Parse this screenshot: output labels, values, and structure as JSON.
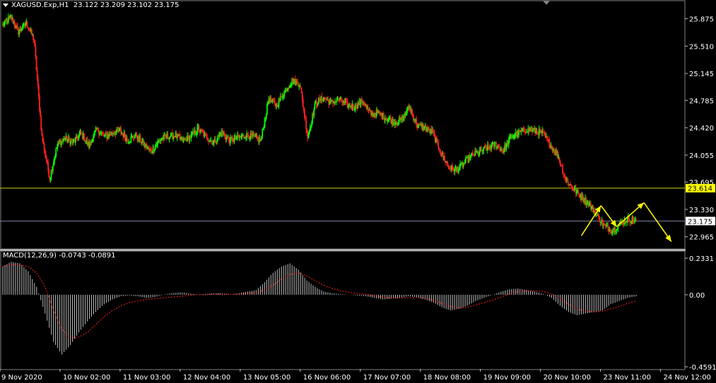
{
  "header": {
    "symbol": "XAGUSD.Exp,H1",
    "ohlc": "23.122 23.209 23.102 23.175"
  },
  "macd_header": {
    "label": "MACD(12,26,9)",
    "values": "-0.0743 -0.0891"
  },
  "colors": {
    "background": "#000000",
    "bull_candle": "#00ff00",
    "bear_candle": "#ff2020",
    "level_line": "#cccc00",
    "current_price_line": "#8080a0",
    "arrows": "#ffff00",
    "macd_hist": "#c0c0c0",
    "macd_signal": "#ff2020"
  },
  "chart_data": [
    {
      "type": "candlestick",
      "title": "XAGUSD.Exp,H1",
      "y_ticks": [
        "25.875",
        "25.510",
        "25.145",
        "24.785",
        "24.420",
        "24.055",
        "23.695",
        "23.330",
        "22.965"
      ],
      "ylim": [
        22.83,
        26.05
      ],
      "x_tick_labels": [
        "9 Nov 2020",
        "10 Nov 02:00",
        "11 Nov 03:00",
        "12 Nov 04:00",
        "13 Nov 05:00",
        "16 Nov 06:00",
        "17 Nov 07:00",
        "18 Nov 08:00",
        "19 Nov 09:00",
        "20 Nov 10:00",
        "23 Nov 11:00",
        "24 Nov 12:00"
      ],
      "horizontal_levels": [
        {
          "value": 23.614,
          "label": "23.614",
          "kind": "level"
        },
        {
          "value": 23.175,
          "label": "23.175",
          "kind": "current_price"
        }
      ],
      "close_path": [
        25.78,
        25.9,
        25.7,
        25.82,
        25.6,
        24.3,
        23.75,
        24.2,
        24.28,
        24.22,
        24.35,
        24.18,
        24.4,
        24.3,
        24.35,
        24.38,
        24.25,
        24.32,
        24.2,
        24.1,
        24.25,
        24.3,
        24.32,
        24.25,
        24.3,
        24.4,
        24.3,
        24.22,
        24.35,
        24.25,
        24.28,
        24.32,
        24.3,
        24.25,
        24.8,
        24.72,
        24.9,
        25.05,
        25.0,
        24.3,
        24.75,
        24.82,
        24.75,
        24.8,
        24.72,
        24.7,
        24.78,
        24.6,
        24.62,
        24.55,
        24.5,
        24.52,
        24.7,
        24.45,
        24.42,
        24.35,
        24.1,
        23.9,
        23.85,
        23.95,
        24.05,
        24.1,
        24.15,
        24.2,
        24.12,
        24.3,
        24.35,
        24.4,
        24.38,
        24.35,
        24.2,
        24.05,
        23.72,
        23.6,
        23.5,
        23.4,
        23.25,
        23.1,
        23.05,
        23.15,
        23.2,
        23.175
      ],
      "annotations": [
        {
          "kind": "arrow",
          "from": [
            74.0,
            22.98
          ],
          "to": [
            76.5,
            23.38
          ]
        },
        {
          "kind": "arrow",
          "from": [
            76.5,
            23.38
          ],
          "to": [
            78.5,
            23.1
          ]
        },
        {
          "kind": "arrow",
          "from": [
            78.5,
            23.1
          ],
          "to": [
            82.0,
            23.42
          ]
        },
        {
          "kind": "arrow",
          "from": [
            82.0,
            23.42
          ],
          "to": [
            85.5,
            22.9
          ]
        }
      ]
    },
    {
      "type": "bar",
      "title": "MACD(12,26,9)",
      "y_ticks": [
        "0.2331",
        "0.00",
        "-0.4591"
      ],
      "ylim": [
        -0.4591,
        0.2331
      ],
      "series": [
        {
          "name": "histogram",
          "values": [
            0.18,
            0.21,
            0.2,
            0.15,
            0.05,
            -0.12,
            -0.3,
            -0.38,
            -0.32,
            -0.24,
            -0.17,
            -0.11,
            -0.06,
            -0.03,
            -0.01,
            -0.005,
            -0.01,
            -0.02,
            -0.015,
            0.0,
            0.01,
            0.015,
            0.01,
            0.0,
            0.005,
            0.01,
            0.01,
            0.0,
            0.01,
            0.02,
            0.03,
            0.08,
            0.14,
            0.18,
            0.2,
            0.16,
            0.09,
            0.05,
            0.02,
            0.01,
            0.005,
            0.0,
            -0.005,
            -0.01,
            -0.02,
            -0.03,
            -0.025,
            -0.02,
            -0.01,
            -0.015,
            -0.03,
            -0.05,
            -0.08,
            -0.1,
            -0.09,
            -0.07,
            -0.04,
            -0.02,
            0.0,
            0.02,
            0.035,
            0.04,
            0.03,
            0.02,
            0.005,
            -0.02,
            -0.07,
            -0.11,
            -0.13,
            -0.12,
            -0.11,
            -0.1,
            -0.06,
            -0.04,
            -0.02,
            -0.01
          ]
        },
        {
          "name": "signal",
          "values": [
            0.18,
            0.19,
            0.19,
            0.18,
            0.14,
            0.05,
            -0.1,
            -0.22,
            -0.28,
            -0.27,
            -0.24,
            -0.19,
            -0.14,
            -0.1,
            -0.07,
            -0.05,
            -0.04,
            -0.03,
            -0.025,
            -0.02,
            -0.015,
            -0.01,
            -0.005,
            0.0,
            0.0,
            0.002,
            0.004,
            0.003,
            0.004,
            0.008,
            0.012,
            0.03,
            0.06,
            0.1,
            0.13,
            0.14,
            0.12,
            0.09,
            0.06,
            0.04,
            0.025,
            0.015,
            0.008,
            0.003,
            -0.005,
            -0.015,
            -0.02,
            -0.02,
            -0.018,
            -0.018,
            -0.023,
            -0.035,
            -0.055,
            -0.075,
            -0.085,
            -0.08,
            -0.065,
            -0.05,
            -0.035,
            -0.015,
            0.005,
            0.02,
            0.025,
            0.025,
            0.02,
            0.005,
            -0.025,
            -0.06,
            -0.09,
            -0.105,
            -0.11,
            -0.105,
            -0.09,
            -0.075,
            -0.055,
            -0.04
          ]
        }
      ]
    }
  ]
}
